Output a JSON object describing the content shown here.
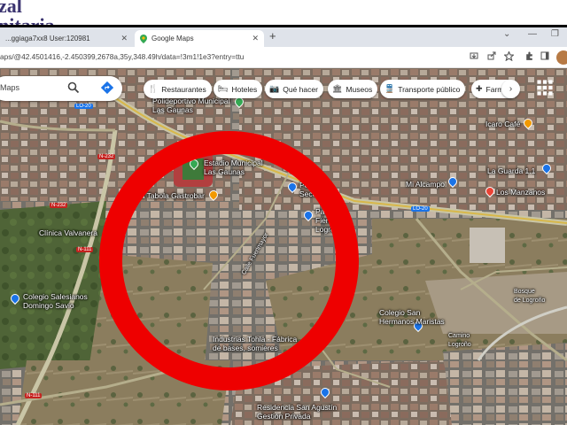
{
  "brand": {
    "line1": "zal",
    "line2": "nitaria"
  },
  "tabs": [
    {
      "label": "...ggiaga7xx8 User:120981",
      "close": "✕",
      "active": false
    },
    {
      "label": "Google Maps",
      "close": "✕",
      "active": true
    }
  ],
  "newtab_label": "+",
  "window_controls": {
    "chevron": "⌄",
    "minimize": "—",
    "maximize": "❐"
  },
  "address": {
    "url": "aps/@42.4501416,-2.450399,2678a,35y,348.49h/data=!3m1!1e3?entry=ttu"
  },
  "search": {
    "placeholder": "Maps"
  },
  "chips": [
    {
      "label": "Restaurantes",
      "icon": "fork-knife-icon",
      "glyph": "🍴"
    },
    {
      "label": "Hoteles",
      "icon": "bed-icon",
      "glyph": "🛏"
    },
    {
      "label": "Qué hacer",
      "icon": "camera-icon",
      "glyph": "📷"
    },
    {
      "label": "Museos",
      "icon": "museum-icon",
      "glyph": "🏛"
    },
    {
      "label": "Transporte público",
      "icon": "train-icon",
      "glyph": "🚆"
    },
    {
      "label": "Farm",
      "icon": "pharmacy-icon",
      "glyph": "✚"
    }
  ],
  "chip_next": "›",
  "places": [
    {
      "label": "Polideportivo Municipal\nLas Gaunas",
      "pin": "#34a853"
    },
    {
      "label": "Icaro Café",
      "pin": "#f29900"
    },
    {
      "label": "La Guarda 1.1",
      "pin": "#1a73e8"
    },
    {
      "label": "Mi Alcampo",
      "pin": "#1a73e8"
    },
    {
      "label": "Los Manzanos",
      "pin": "#ea4335"
    },
    {
      "label": "Estadio Municipal\nLas Gaunas",
      "pin": "#34a853"
    },
    {
      "label": "La Tabola Gastrobar",
      "pin": "#f29900"
    },
    {
      "label": "Clínica Valvanera",
      "pin": "#ea4335"
    },
    {
      "label": "Colegio Salesianos\nDomingo Savio",
      "pin": "#1a73e8"
    },
    {
      "label": "Colegio San\nHermanos Maristas",
      "pin": "#1a73e8"
    },
    {
      "label": "Industrias Tohla - Fábrica\nde bases, somieres",
      "pin": "#1a73e8"
    },
    {
      "label": "Residencia San Agustín\nGestión Privada",
      "pin": "#1a73e8"
    },
    {
      "label": "Paseo\nFiendejay\nLogroño",
      "pin": "#1a73e8"
    },
    {
      "label": "Pelotón\nSeco",
      "pin": "#1a73e8"
    },
    {
      "label": "Calle Fuenmayor",
      "pin": ""
    },
    {
      "label": "Bosque\nde Logroño",
      "pin": ""
    },
    {
      "label": "Camino\nLogroño",
      "pin": ""
    }
  ],
  "road_shields": [
    "LO-20",
    "LO-20",
    "N-111",
    "N-111",
    "N-232",
    "N-232"
  ],
  "colors": {
    "ring": "#ee0000",
    "chrome_tabs": "#dfe3ea",
    "brand": "#3b3470"
  }
}
